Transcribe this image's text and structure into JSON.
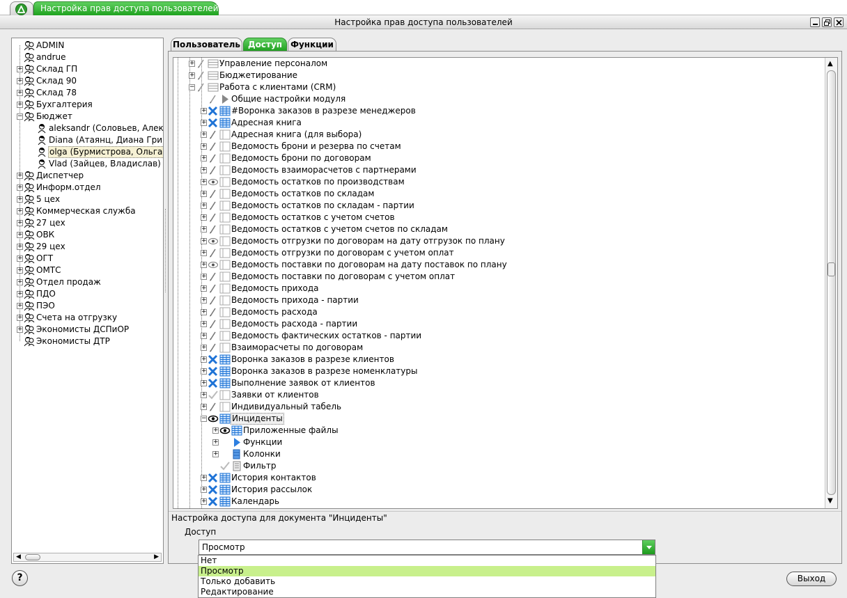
{
  "app": {
    "tab_title": "Настройка прав доступа пользователей",
    "window_title": "Настройка прав доступа пользователей"
  },
  "left_tree": {
    "items": [
      {
        "label": "ADMIN",
        "level": 0,
        "expander": "none",
        "icon": "user-group-icon"
      },
      {
        "label": "andrue",
        "level": 0,
        "expander": "none",
        "icon": "user-group-icon"
      },
      {
        "label": "Склад ГП",
        "level": 0,
        "expander": "plus",
        "icon": "user-group-icon"
      },
      {
        "label": "Склад 90",
        "level": 0,
        "expander": "plus",
        "icon": "user-group-icon"
      },
      {
        "label": "Склад 78",
        "level": 0,
        "expander": "plus",
        "icon": "user-group-icon"
      },
      {
        "label": "Бухгалтерия",
        "level": 0,
        "expander": "plus",
        "icon": "user-group-icon"
      },
      {
        "label": "Бюджет",
        "level": 0,
        "expander": "minus",
        "icon": "user-group-icon"
      },
      {
        "label": "aleksandr (Соловьев, Алекс",
        "level": 1,
        "expander": "none",
        "icon": "user-icon"
      },
      {
        "label": "Diana (Атаянц, Диана Григо",
        "level": 1,
        "expander": "none",
        "icon": "user-icon"
      },
      {
        "label": "olga (Бурмистрова, Ольга)",
        "level": 1,
        "expander": "none",
        "icon": "user-icon",
        "selected": true
      },
      {
        "label": "Vlad (Зайцев, Владислав)",
        "level": 1,
        "expander": "none",
        "icon": "user-icon"
      },
      {
        "label": "Диспетчер",
        "level": 0,
        "expander": "plus",
        "icon": "user-group-icon"
      },
      {
        "label": "Информ.отдел",
        "level": 0,
        "expander": "plus",
        "icon": "user-group-icon"
      },
      {
        "label": "5 цех",
        "level": 0,
        "expander": "plus",
        "icon": "user-group-icon"
      },
      {
        "label": "Коммерческая служба",
        "level": 0,
        "expander": "plus",
        "icon": "user-group-icon"
      },
      {
        "label": "27 цех",
        "level": 0,
        "expander": "plus",
        "icon": "user-group-icon"
      },
      {
        "label": "ОВК",
        "level": 0,
        "expander": "plus",
        "icon": "user-group-icon"
      },
      {
        "label": "29 цех",
        "level": 0,
        "expander": "plus",
        "icon": "user-group-icon"
      },
      {
        "label": "ОГТ",
        "level": 0,
        "expander": "plus",
        "icon": "user-group-icon"
      },
      {
        "label": "ОМТС",
        "level": 0,
        "expander": "plus",
        "icon": "user-group-icon"
      },
      {
        "label": "Отдел продаж",
        "level": 0,
        "expander": "plus",
        "icon": "user-group-icon"
      },
      {
        "label": "ПДО",
        "level": 0,
        "expander": "plus",
        "icon": "user-group-icon"
      },
      {
        "label": "ПЭО",
        "level": 0,
        "expander": "plus",
        "icon": "user-group-icon"
      },
      {
        "label": "Счета на отгрузку",
        "level": 0,
        "expander": "plus",
        "icon": "user-group-icon"
      },
      {
        "label": "Экономисты ДСПиОР",
        "level": 0,
        "expander": "plus",
        "icon": "user-group-icon"
      },
      {
        "label": "Экономисты ДТР",
        "level": 0,
        "expander": "none",
        "icon": "user-group-icon"
      }
    ]
  },
  "tabs": [
    {
      "label": "Пользователь",
      "active": false
    },
    {
      "label": "Доступ",
      "active": true
    },
    {
      "label": "Функции",
      "active": false
    }
  ],
  "access_tree": {
    "items": [
      {
        "label": "Управление персоналом",
        "level": 0,
        "expander": "plus",
        "access": "edit-gray-icon",
        "type": "list-icon"
      },
      {
        "label": "Бюджетирование",
        "level": 0,
        "expander": "plus",
        "access": "edit-gray-icon",
        "type": "list-icon"
      },
      {
        "label": "Работа с клиентами (CRM)",
        "level": 0,
        "expander": "minus",
        "access": "edit-gray-icon",
        "type": "list-icon"
      },
      {
        "label": "Общие настройки модуля",
        "level": 1,
        "expander": "none",
        "access": "edit-gray-icon",
        "type": "function-icon"
      },
      {
        "label": "#Воронка заказов в разрезе менеджеров",
        "level": 1,
        "expander": "plus",
        "access": "deny-icon",
        "type": "table-blue-icon"
      },
      {
        "label": "Адресная книга",
        "level": 1,
        "expander": "plus",
        "access": "deny-icon",
        "type": "table-blue-icon"
      },
      {
        "label": "Адресная книга (для выбора)",
        "level": 1,
        "expander": "plus",
        "access": "edit-icon",
        "type": "table-icon"
      },
      {
        "label": "Ведомость брони и резерва по счетам",
        "level": 1,
        "expander": "plus",
        "access": "edit-icon",
        "type": "table-icon"
      },
      {
        "label": "Ведомость брони по договорам",
        "level": 1,
        "expander": "plus",
        "access": "edit-icon",
        "type": "table-icon"
      },
      {
        "label": "Ведомость взаиморасчетов с партнерами",
        "level": 1,
        "expander": "plus",
        "access": "edit-icon",
        "type": "table-icon"
      },
      {
        "label": "Ведомость остатков по производствам",
        "level": 1,
        "expander": "plus",
        "access": "view-icon",
        "type": "table-icon"
      },
      {
        "label": "Ведомость остатков по складам",
        "level": 1,
        "expander": "plus",
        "access": "edit-icon",
        "type": "table-icon"
      },
      {
        "label": "Ведомость остатков по складам - партии",
        "level": 1,
        "expander": "plus",
        "access": "edit-icon",
        "type": "table-icon"
      },
      {
        "label": "Ведомость остатков с учетом счетов",
        "level": 1,
        "expander": "plus",
        "access": "edit-icon",
        "type": "table-icon"
      },
      {
        "label": "Ведомость остатков с учетом счетов по складам",
        "level": 1,
        "expander": "plus",
        "access": "edit-icon",
        "type": "table-icon"
      },
      {
        "label": "Ведомость отгрузки по договорам на дату отгрузок по плану",
        "level": 1,
        "expander": "plus",
        "access": "view-icon",
        "type": "table-icon"
      },
      {
        "label": "Ведомость отгрузки по договорам с учетом оплат",
        "level": 1,
        "expander": "plus",
        "access": "edit-icon",
        "type": "table-icon"
      },
      {
        "label": "Ведомость поставки по договорам на дату поставок по плану",
        "level": 1,
        "expander": "plus",
        "access": "view-icon",
        "type": "table-icon"
      },
      {
        "label": "Ведомость поставки по договорам с учетом оплат",
        "level": 1,
        "expander": "plus",
        "access": "edit-icon",
        "type": "table-icon"
      },
      {
        "label": "Ведомость прихода",
        "level": 1,
        "expander": "plus",
        "access": "edit-icon",
        "type": "table-icon"
      },
      {
        "label": "Ведомость прихода - партии",
        "level": 1,
        "expander": "plus",
        "access": "edit-icon",
        "type": "table-icon"
      },
      {
        "label": "Ведомость расхода",
        "level": 1,
        "expander": "plus",
        "access": "edit-icon",
        "type": "table-icon"
      },
      {
        "label": "Ведомость расхода - партии",
        "level": 1,
        "expander": "plus",
        "access": "edit-icon",
        "type": "table-icon"
      },
      {
        "label": "Ведомость фактических остатков - партии",
        "level": 1,
        "expander": "plus",
        "access": "edit-icon",
        "type": "table-icon"
      },
      {
        "label": "Взаиморасчеты по договорам",
        "level": 1,
        "expander": "plus",
        "access": "edit-icon",
        "type": "table-icon"
      },
      {
        "label": "Воронка заказов в разрезе клиентов",
        "level": 1,
        "expander": "plus",
        "access": "deny-icon",
        "type": "table-blue-icon"
      },
      {
        "label": "Воронка заказов в разрезе номенклатуры",
        "level": 1,
        "expander": "plus",
        "access": "deny-icon",
        "type": "table-blue-icon"
      },
      {
        "label": "Выполнение заявок от клиентов",
        "level": 1,
        "expander": "plus",
        "access": "deny-icon",
        "type": "table-blue-icon"
      },
      {
        "label": "Заявки от клиентов",
        "level": 1,
        "expander": "plus",
        "access": "check-gray-icon",
        "type": "table-icon"
      },
      {
        "label": "Индивидуальный табель",
        "level": 1,
        "expander": "plus",
        "access": "edit-icon",
        "type": "table-icon"
      },
      {
        "label": "Инциденты",
        "level": 1,
        "expander": "minus",
        "access": "view-bold-icon",
        "type": "table-blue-icon",
        "selected": true
      },
      {
        "label": "Приложенные файлы",
        "level": 2,
        "expander": "plus",
        "access": "view-bold-icon",
        "type": "table-blue-icon"
      },
      {
        "label": "Функции",
        "level": 2,
        "expander": "plus",
        "access": "none",
        "type": "function-blue-icon"
      },
      {
        "label": "Колонки",
        "level": 2,
        "expander": "plus",
        "access": "none",
        "type": "columns-icon"
      },
      {
        "label": "Фильтр",
        "level": 2,
        "expander": "none",
        "access": "check-gray-icon",
        "type": "filter-icon"
      },
      {
        "label": "История контактов",
        "level": 1,
        "expander": "plus",
        "access": "deny-icon",
        "type": "table-blue-icon"
      },
      {
        "label": "История рассылок",
        "level": 1,
        "expander": "plus",
        "access": "deny-icon",
        "type": "table-blue-icon"
      },
      {
        "label": "Календарь",
        "level": 1,
        "expander": "plus",
        "access": "deny-icon",
        "type": "table-blue-icon"
      }
    ]
  },
  "status": {
    "text": "Настройка доступа для документа \"Инциденты\""
  },
  "access": {
    "label": "Доступ",
    "selected": "Просмотр",
    "options": [
      "Нет",
      "Просмотр",
      "Только добавить",
      "Редактирование"
    ],
    "highlighted_index": 1
  },
  "footer": {
    "help_label": "?",
    "exit_label": "Выход"
  },
  "colors": {
    "accent_green": "#1fa21f",
    "highlight_green": "#c8f08c",
    "selection_bg": "#f6f1d4",
    "deny_blue": "#1e73d6"
  }
}
